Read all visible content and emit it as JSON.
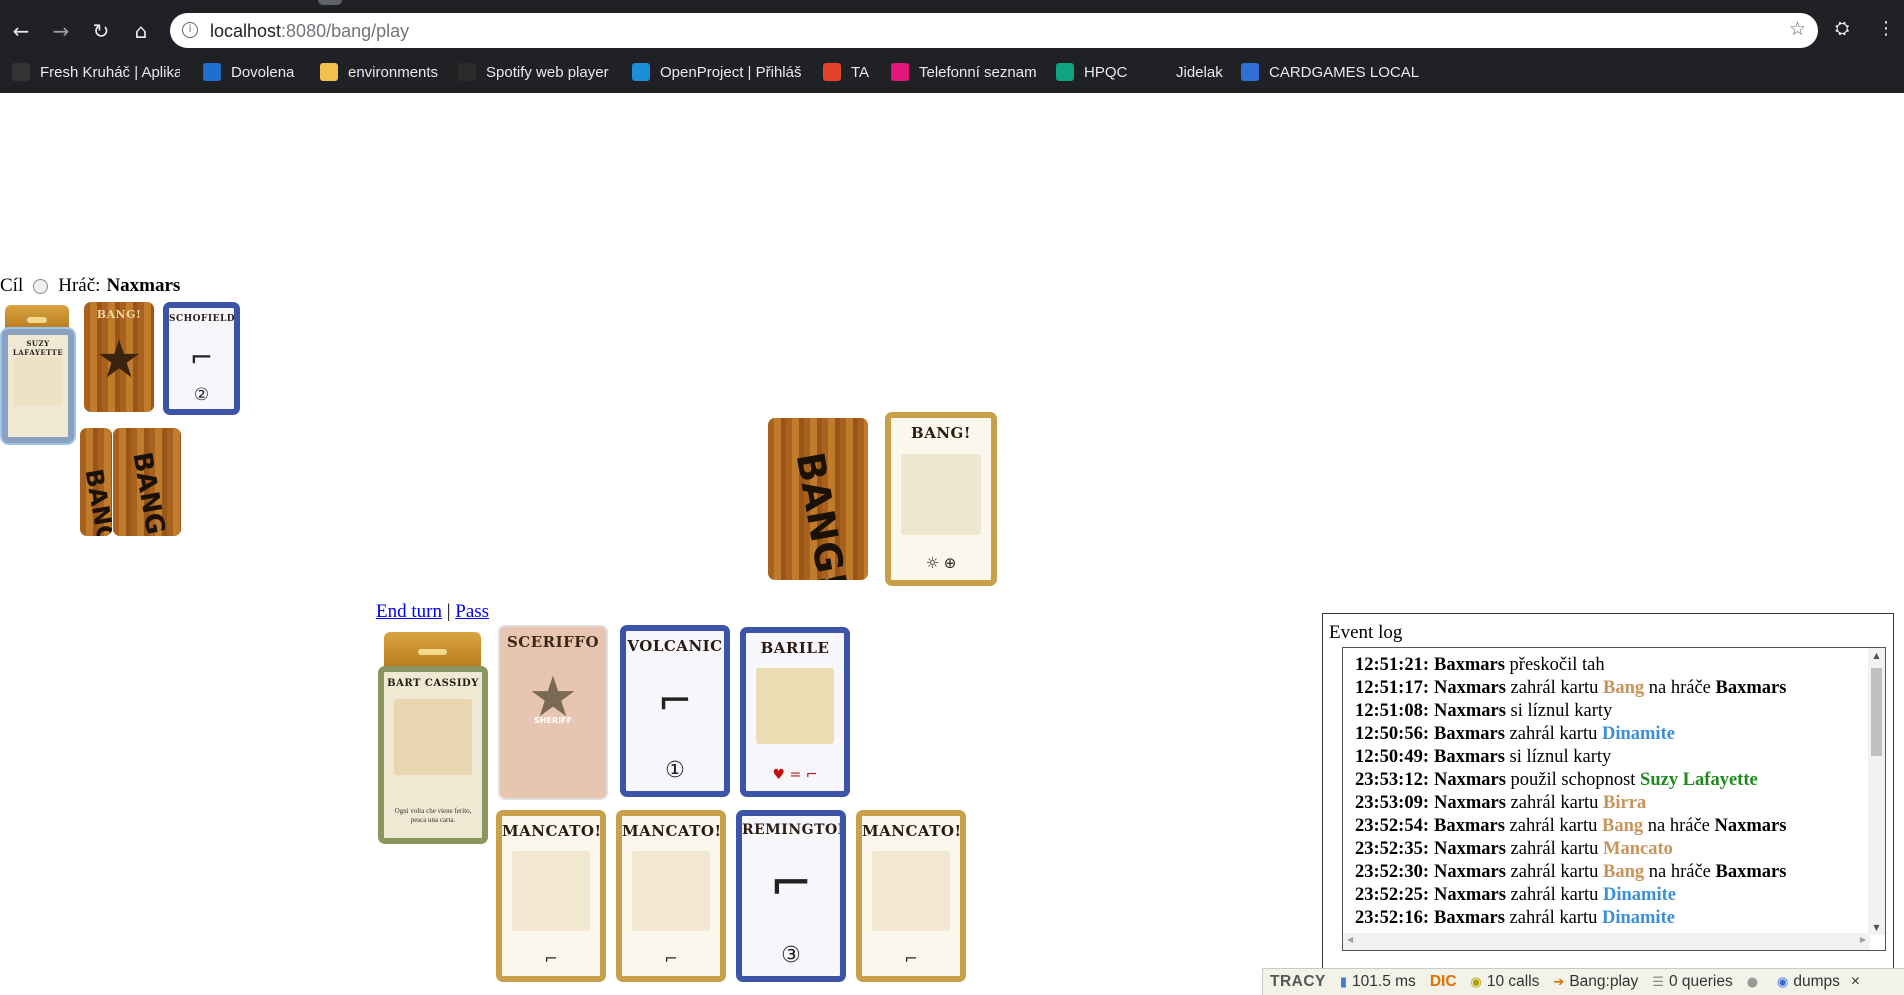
{
  "browser": {
    "url_host": "localhost",
    "url_rest": ":8080/bang/play",
    "bookmarks": [
      {
        "label": "Fresh Kruháč | Aplika",
        "icon": "fresh-icon",
        "color": "#333333"
      },
      {
        "label": "Dovolena",
        "icon": "dovolena-icon",
        "color": "#1e6fc9"
      },
      {
        "label": "environments",
        "icon": "folder-icon",
        "color": "#f3c04b"
      },
      {
        "label": "Spotify web player",
        "icon": "spotify-icon",
        "color": "#2b2b2b"
      },
      {
        "label": "OpenProject | Přihláš",
        "icon": "openproject-icon",
        "color": "#1a8ed6"
      },
      {
        "label": "TA",
        "icon": "gitlab-icon",
        "color": "#e24329"
      },
      {
        "label": "Telefonní seznam",
        "icon": "phone-icon",
        "color": "#e3177a"
      },
      {
        "label": "HPQC",
        "icon": "hpqc-icon",
        "color": "#10a37f"
      },
      {
        "label": "Jidelak",
        "icon": "page-icon",
        "color": "#202124"
      },
      {
        "label": "CARDGAMES LOCAL",
        "icon": "cardgames-icon",
        "color": "#2f6fd6"
      }
    ]
  },
  "player": {
    "target_label": "Cíl",
    "player_label": "Hráč:",
    "player_name": "Naxmars"
  },
  "opponent_cards": {
    "character": "SUZY LAFAYETTE",
    "bang": "BANG!",
    "schofield": "SCHOFIELD",
    "schofield_range": "②"
  },
  "table_cards": {
    "discard_top": "BANG!",
    "deck_word": "BANG!"
  },
  "actions": {
    "end_turn": "End turn",
    "separator": "|",
    "pass": "Pass"
  },
  "my_cards": {
    "character": "BART CASSIDY",
    "character_desc": "Ogni volta che viene ferito, pesca una carta.",
    "sceriffo": "SCERIFFO",
    "sheriff_badge": "SHERIFF",
    "volcanic": "VOLCANIC",
    "volcanic_range": "①",
    "barile": "BARILE",
    "mancato": "MANCATO!",
    "remington": "REMINGTON",
    "remington_range": "③"
  },
  "event_log": {
    "title": "Event log",
    "entries": [
      {
        "time": "12:51:21:",
        "actor": "Baxmars",
        "text": " přeskočil tah",
        "card": "",
        "card_class": "",
        "tail": "",
        "target": ""
      },
      {
        "time": "12:51:17:",
        "actor": "Naxmars",
        "text": " zahrál kartu ",
        "card": "Bang",
        "card_class": "bang",
        "tail": " na hráče ",
        "target": "Baxmars"
      },
      {
        "time": "12:51:08:",
        "actor": "Naxmars",
        "text": " si líznul karty",
        "card": "",
        "card_class": "",
        "tail": "",
        "target": ""
      },
      {
        "time": "12:50:56:",
        "actor": "Baxmars",
        "text": " zahrál kartu ",
        "card": "Dinamite",
        "card_class": "dinamite",
        "tail": "",
        "target": ""
      },
      {
        "time": "12:50:49:",
        "actor": "Baxmars",
        "text": " si líznul karty",
        "card": "",
        "card_class": "",
        "tail": "",
        "target": ""
      },
      {
        "time": "23:53:12:",
        "actor": "Naxmars",
        "text": " použil schopnost ",
        "card": "Suzy Lafayette",
        "card_class": "suzy",
        "tail": "",
        "target": ""
      },
      {
        "time": "23:53:09:",
        "actor": "Naxmars",
        "text": " zahrál kartu ",
        "card": "Birra",
        "card_class": "birra",
        "tail": "",
        "target": ""
      },
      {
        "time": "23:52:54:",
        "actor": "Baxmars",
        "text": " zahrál kartu ",
        "card": "Bang",
        "card_class": "bang",
        "tail": " na hráče ",
        "target": "Naxmars"
      },
      {
        "time": "23:52:35:",
        "actor": "Naxmars",
        "text": " zahrál kartu ",
        "card": "Mancato",
        "card_class": "mancato",
        "tail": "",
        "target": ""
      },
      {
        "time": "23:52:30:",
        "actor": "Naxmars",
        "text": " zahrál kartu ",
        "card": "Bang",
        "card_class": "bang",
        "tail": " na hráče ",
        "target": "Baxmars"
      },
      {
        "time": "23:52:25:",
        "actor": "Naxmars",
        "text": " zahrál kartu ",
        "card": "Dinamite",
        "card_class": "dinamite",
        "tail": "",
        "target": ""
      },
      {
        "time": "23:52:16:",
        "actor": "Baxmars",
        "text": " zahrál kartu ",
        "card": "Dinamite",
        "card_class": "dinamite",
        "tail": "",
        "target": ""
      }
    ]
  },
  "tracy": {
    "logo": "TRACY",
    "time": "101.5 ms",
    "dic": "DIC",
    "calls": "10 calls",
    "route": "Bang:play",
    "queries": "0 queries",
    "dumps": "dumps",
    "close": "×"
  }
}
